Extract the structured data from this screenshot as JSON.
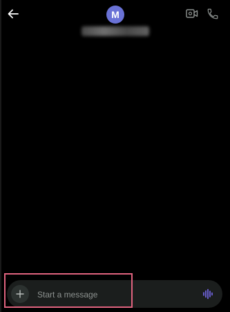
{
  "header": {
    "avatar_initial": "M",
    "back_icon": "arrow-left-icon",
    "video_icon": "video-camera-icon",
    "call_icon": "phone-icon"
  },
  "composer": {
    "placeholder": "Start a message",
    "add_icon": "plus-icon",
    "voice_icon": "waveform-icon"
  },
  "colors": {
    "background": "#000000",
    "avatar": "#6a72d6",
    "composer_bg": "#1b1e1d",
    "voice_accent": "#7b6cf6",
    "highlight": "#e0637f"
  }
}
